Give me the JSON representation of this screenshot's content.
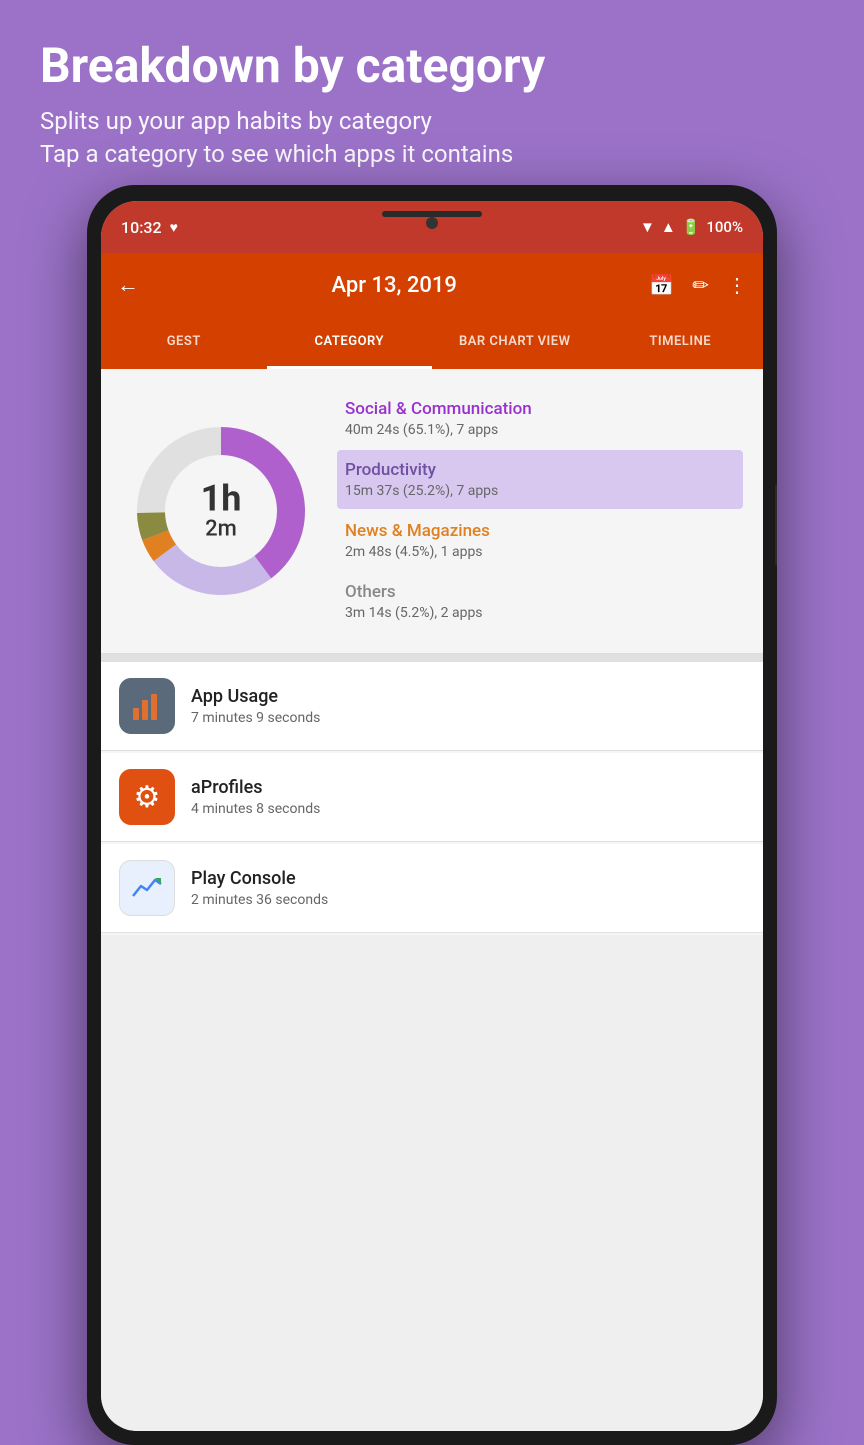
{
  "header": {
    "title": "Breakdown by category",
    "subtitle_line1": "Splits up your app habits by category",
    "subtitle_line2": "Tap a category to see which apps it contains"
  },
  "status_bar": {
    "time": "10:32",
    "battery": "100%",
    "battery_icon": "🔋",
    "wifi_icon": "▲",
    "signal_icon": "▲"
  },
  "toolbar": {
    "back_icon": "←",
    "date": "Apr 13, 2019",
    "calendar_icon": "📅",
    "edit_icon": "✏",
    "more_icon": "⋮"
  },
  "tabs": [
    {
      "label": "GEST",
      "active": false
    },
    {
      "label": "CATEGORY",
      "active": true
    },
    {
      "label": "BAR CHART VIEW",
      "active": false
    },
    {
      "label": "TIMELINE",
      "active": false
    }
  ],
  "donut": {
    "time_hour": "1h",
    "time_min": "2m",
    "segments": [
      {
        "label": "Social & Communication",
        "percent": 65.1,
        "color": "#b060cc",
        "stroke_dasharray": "204.7 314.2",
        "stroke_dashoffset": "0"
      },
      {
        "label": "Productivity",
        "percent": 25.2,
        "color": "#c8b8e8",
        "stroke_dasharray": "79.2 314.2",
        "stroke_dashoffset": "-204.7"
      },
      {
        "label": "News & Magazines",
        "percent": 4.5,
        "color": "#e08020",
        "stroke_dasharray": "14.1 314.2",
        "stroke_dashoffset": "-283.9"
      },
      {
        "label": "Others",
        "percent": 5.2,
        "color": "#a0a040",
        "stroke_dasharray": "16.3 314.2",
        "stroke_dashoffset": "-298.0"
      }
    ]
  },
  "legend_items": [
    {
      "name": "Social & Communication",
      "detail": "40m 24s (65.1%), 7 apps",
      "color": "#9932cc",
      "highlighted": false
    },
    {
      "name": "Productivity",
      "detail": "15m 37s (25.2%), 7 apps",
      "color": "#8060b0",
      "highlighted": true
    },
    {
      "name": "News & Magazines",
      "detail": "2m 48s (4.5%), 1 apps",
      "color": "#e08020",
      "highlighted": false
    },
    {
      "name": "Others",
      "detail": "3m 14s (5.2%), 2 apps",
      "color": "#888888",
      "highlighted": false
    }
  ],
  "app_list": [
    {
      "name": "App Usage",
      "time": "7 minutes 9 seconds",
      "icon_type": "usage",
      "icon_symbol": "📊"
    },
    {
      "name": "aProfiles",
      "time": "4 minutes 8 seconds",
      "icon_type": "aprofiles",
      "icon_symbol": "⚙"
    },
    {
      "name": "Play Console",
      "time": "2 minutes 36 seconds",
      "icon_type": "playconsole",
      "icon_symbol": "📈"
    }
  ]
}
